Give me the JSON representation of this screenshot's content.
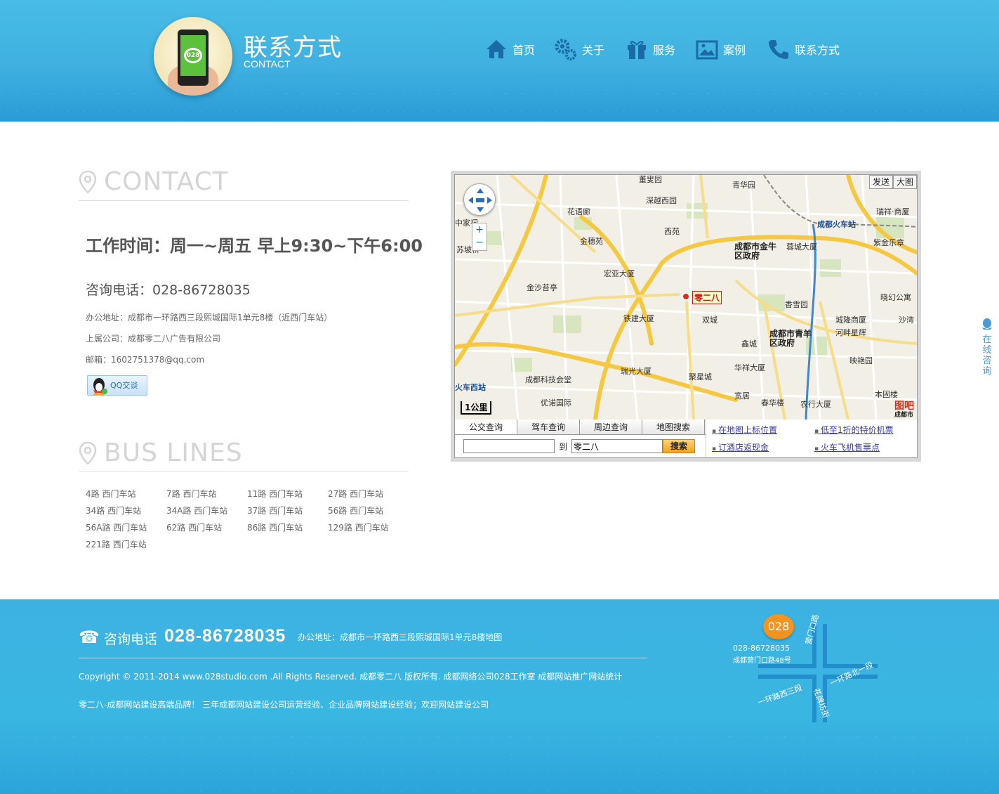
{
  "header": {
    "title": "联系方式",
    "subtitle": "CONTACT",
    "logo_text": "028",
    "nav": [
      {
        "label": "首页",
        "icon": "home-icon"
      },
      {
        "label": "关于",
        "icon": "gears-icon"
      },
      {
        "label": "服务",
        "icon": "gift-icon"
      },
      {
        "label": "案例",
        "icon": "image-icon"
      },
      {
        "label": "联系方式",
        "icon": "phone-icon"
      }
    ]
  },
  "contact": {
    "heading": "CONTACT",
    "hours": "工作时间：周一~周五 早上9:30~下午6:00",
    "phone": "咨询电话：028-86728035",
    "address": "办公地址：成都市一环路西三段熙城国际1单元8楼（近西门车站）",
    "company": "上属公司：成都零二八广告有限公司",
    "email": "邮箱：1602751378@qq.com",
    "qq_button": "QQ交谈"
  },
  "bus": {
    "heading": "BUS LINES",
    "lines": [
      "4路 西门车站",
      "7路 西门车站",
      "11路 西门车站",
      "27路 西门车站",
      "34路 西门车站",
      "34A路 西门车站",
      "37路 西门车站",
      "56路 西门车站",
      "56A路 西门车站",
      "62路 西门车站",
      "86路 西门车站",
      "129路 西门车站",
      "221路 西门车站"
    ]
  },
  "map": {
    "tools": [
      "发送",
      "大图"
    ],
    "marker": "零二八",
    "scale": "1公里",
    "logo": "图吧",
    "logo_sub": "成都市",
    "labels": {
      "gov1": "成都市金牛区政府",
      "gov2": "成都市青羊区政府",
      "station": "成都火车站",
      "west_station": "火车西站",
      "p1": "花语廊",
      "p2": "深越西园",
      "p3": "西苑",
      "p4": "金穗苑",
      "p5": "宏亚大厦",
      "p6": "金沙苔亭",
      "p7": "铁建大厦",
      "p8": "香雪园",
      "p9": "蓉城大厦",
      "p10": "城隆商厦",
      "p11": "河畔星辉",
      "p12": "鑫城",
      "p13": "华祥大厦",
      "p14": "成都科技会堂",
      "p15": "瑞光大厦",
      "p16": "聚星城",
      "p17": "宽居",
      "p18": "优诺国际",
      "p19": "春华楼",
      "p20": "农行大厦",
      "p21": "映艳园",
      "p22": "紫金乐章",
      "p23": "晓幻公寓",
      "p24": "本固楼",
      "p25": "青华园",
      "p26": "董叟园",
      "p27": "双城",
      "p28": "苏坡桥",
      "p29": "中家祠",
      "p30": "瑞祥·商厦",
      "p31": "沙湾"
    },
    "tabs": [
      "公交查询",
      "驾车查询",
      "周边查询",
      "地图搜索"
    ],
    "to_label": "到",
    "to_value": "零二八",
    "search_btn": "搜索",
    "links": [
      "在地图上标位置",
      "低至1折的特价机票",
      "订酒店返现金",
      "火车飞机售票点"
    ]
  },
  "side_float": "在线咨询",
  "footer": {
    "tel_label": "咨询电话",
    "tel_number": "028-86728035",
    "address": "办公地址：成都市一环路西三段熙城国际1单元8楼地图",
    "copyright": "Copyright © 2011-2014 www.028studio.com .All Rights Reserved. 成都零二八 版权所有. 成都网络公司028工作室 成都网站推广网站统计",
    "slogan": "零二八-成都网站建设高端品牌！ 三年成都网站建设公司运营经验、企业品牌网站建设经验；欢迎网站建设公司",
    "badge": "028",
    "map_tel": "028-86728035",
    "map_street": "成都营门口路48号",
    "roads": [
      "营门口路",
      "一环路北一段",
      "一环路西三段",
      "花牌坊街"
    ]
  },
  "colors": {
    "header_blue": "#3fb0e0",
    "nav_icon_blue": "#1a6aa8",
    "marker_red": "#d92e1a",
    "badge_orange": "#f4931f"
  }
}
